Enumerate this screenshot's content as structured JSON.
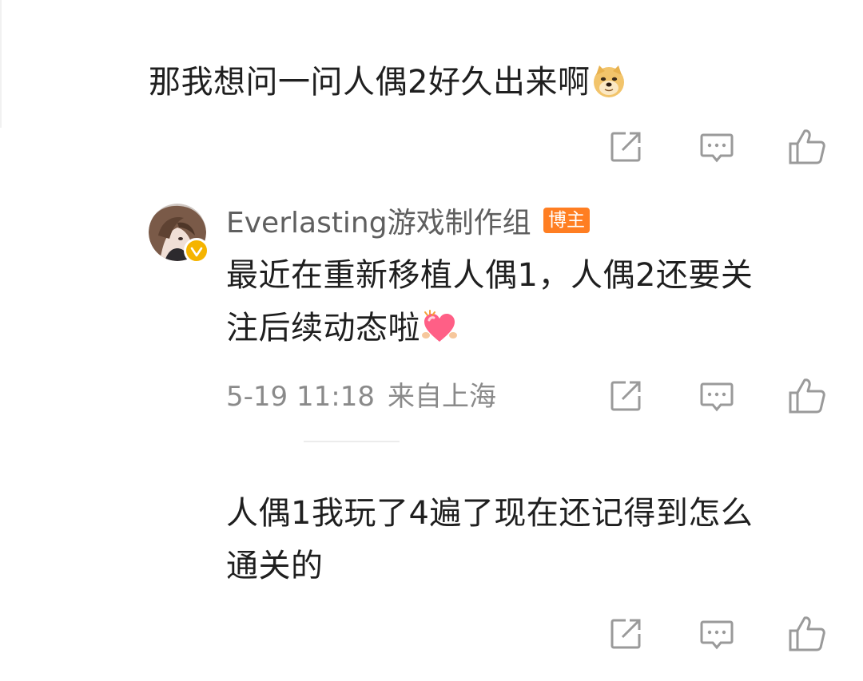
{
  "comments": [
    {
      "text": "那我想问一问人偶2好久出来啊",
      "emoji": "doge-emoji"
    },
    {
      "author": "Everlasting游戏制作组",
      "badge": "博主",
      "verified": true,
      "text_line1": "最近在重新移植人偶1，人偶2还要关",
      "text_line2": "注后续动态啦",
      "emoji": "heart-emoji",
      "date": "5-19 11:18",
      "location": "来自上海"
    },
    {
      "text_line1": "人偶1我玩了4遍了现在还记得到怎么",
      "text_line2": "通关的"
    }
  ],
  "icons": {
    "share": "share-edit-icon",
    "reply": "comment-icon",
    "like": "thumbs-up-icon"
  },
  "colors": {
    "text": "#1f1f1f",
    "muted": "#8a8a8a",
    "badge": "#ff7e22",
    "verified": "#f5b400",
    "icon": "#9a9a9a"
  }
}
